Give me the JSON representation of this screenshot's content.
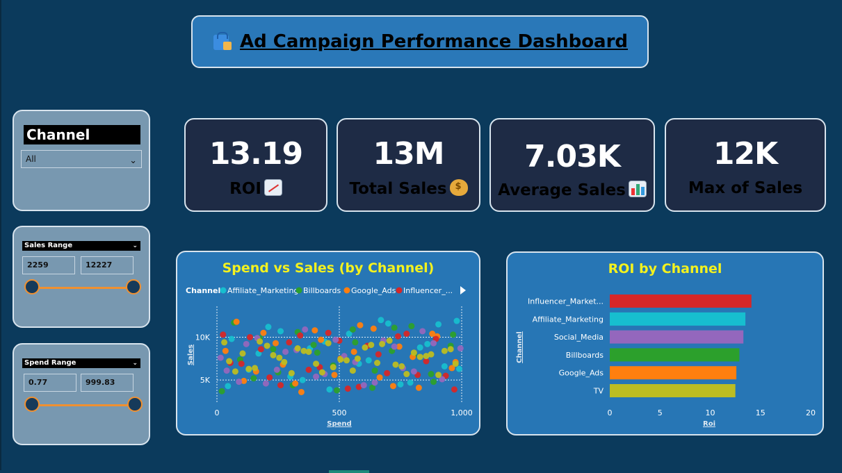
{
  "title": "Ad Campaign Performance Dashboard",
  "title_icon": "shopping-bags-icon",
  "filters": {
    "channel": {
      "label": "Channel",
      "value": "All"
    },
    "sales_range": {
      "label": "Sales Range",
      "min": "2259",
      "max": "12227"
    },
    "spend_range": {
      "label": "Spend Range",
      "min": "0.77",
      "max": "999.83"
    }
  },
  "kpis": [
    {
      "value": "13.19",
      "label": "ROI",
      "icon": "chart-increasing-icon"
    },
    {
      "value": "13M",
      "label": "Total Sales",
      "icon": "money-bag-icon"
    },
    {
      "value": "7.03K",
      "label": "Average Sales",
      "icon": "bar-chart-icon"
    },
    {
      "value": "12K",
      "label": "Max of Sales",
      "icon": ""
    }
  ],
  "colors": {
    "background": "#0b3a5c",
    "panel_blue": "#2776b5",
    "kpi_card": "#1e2b45",
    "chart_title": "#f4f21e",
    "slider": "#f09030",
    "Affiliate_Marketing": "#17becf",
    "Billboards": "#2ca02c",
    "Google_Ads": "#ff7f0e",
    "Influencer_Marketing": "#d62728",
    "Social_Media": "#9467bd",
    "TV": "#bcbd22"
  },
  "chart_data": [
    {
      "type": "scatter",
      "title": "Spend vs Sales (by Channel)",
      "xlabel": "Spend",
      "ylabel": "Sales",
      "legend_title": "Channel",
      "legend_entries": [
        "Affiliate_Marketing",
        "Billboards",
        "Google_Ads",
        "Influencer_..."
      ],
      "legend_position": "top",
      "xlim": [
        0,
        1000
      ],
      "ylim": [
        2259,
        12227
      ],
      "x_ticks": [
        "0",
        "500",
        "1,000"
      ],
      "y_ticks": [
        "5K",
        "10K"
      ],
      "series": [
        {
          "name": "Affiliate_Marketing",
          "x": [
            60,
            130,
            210,
            300,
            380,
            460,
            540,
            620,
            700,
            790,
            860,
            930,
            980,
            45,
            170,
            260,
            350,
            440,
            580,
            670,
            750,
            830,
            905,
            990
          ],
          "y": [
            9800,
            6200,
            11200,
            5400,
            8700,
            3900,
            10400,
            7300,
            11600,
            4700,
            9200,
            6600,
            11900,
            4300,
            8100,
            10700,
            5000,
            9500,
            6900,
            12000,
            4500,
            8800,
            11500,
            6300
          ]
        },
        {
          "name": "Billboards",
          "x": [
            20,
            95,
            175,
            250,
            330,
            410,
            490,
            565,
            645,
            725,
            805,
            885,
            965,
            70,
            150,
            230,
            310,
            395,
            475,
            555,
            635,
            715,
            795,
            875,
            955
          ],
          "y": [
            3700,
            7400,
            9900,
            5900,
            10600,
            8200,
            3800,
            9400,
            6100,
            11100,
            7900,
            4800,
            10300,
            11700,
            5200,
            8600,
            4400,
            9100,
            6700,
            10900,
            4100,
            8400,
            11300,
            5700,
            9000
          ]
        },
        {
          "name": "Google_Ads",
          "x": [
            35,
            110,
            190,
            270,
            345,
            425,
            505,
            585,
            665,
            745,
            825,
            900,
            975,
            80,
            160,
            240,
            320,
            400,
            480,
            560,
            640,
            720,
            800,
            880,
            960
          ],
          "y": [
            8400,
            4900,
            10500,
            6800,
            3600,
            9700,
            7500,
            11400,
            5300,
            8900,
            4100,
            10100,
            7100,
            11800,
            6000,
            9300,
            4600,
            10800,
            5600,
            8300,
            11000,
            4300,
            7700,
            10400,
            6400
          ]
        },
        {
          "name": "Influencer_Marketing",
          "x": [
            25,
            100,
            180,
            260,
            340,
            420,
            500,
            580,
            660,
            740,
            820,
            895,
            970,
            55,
            135,
            215,
            295,
            375,
            455,
            535,
            615,
            695,
            775,
            855,
            935
          ],
          "y": [
            10300,
            6900,
            8600,
            4400,
            10200,
            6500,
            9600,
            4200,
            8000,
            10100,
            5600,
            9800,
            3900,
            7000,
            10000,
            5300,
            9400,
            6200,
            10500,
            4000,
            9000,
            5800,
            10400,
            7200,
            5500
          ]
        },
        {
          "name": "Social_Media",
          "x": [
            40,
            120,
            200,
            280,
            360,
            440,
            520,
            600,
            680,
            760,
            840,
            920,
            995,
            15,
            90,
            165,
            245,
            325,
            405,
            485,
            565,
            645,
            725,
            805,
            885
          ],
          "y": [
            6100,
            9200,
            4600,
            8300,
            10900,
            5700,
            7800,
            4400,
            9600,
            6400,
            10700,
            5100,
            8700,
            7600,
            4800,
            9900,
            6200,
            8500,
            5400,
            9700,
            7100,
            4700,
            8900,
            6000,
            9300
          ]
        },
        {
          "name": "TV",
          "x": [
            50,
            105,
            155,
            205,
            255,
            305,
            355,
            405,
            455,
            505,
            555,
            605,
            655,
            705,
            755,
            805,
            855,
            905,
            955,
            30,
            130,
            230,
            330,
            430,
            530,
            630,
            730,
            830,
            930,
            75,
            175,
            275,
            375,
            475,
            575,
            675,
            775,
            875,
            975
          ],
          "y": [
            7200,
            8100,
            6400,
            9000,
            7600,
            5800,
            8400,
            6900,
            9300,
            7400,
            6100,
            8800,
            7000,
            9600,
            6600,
            8200,
            7800,
            5600,
            8600,
            9400,
            6300,
            7900,
            8700,
            5900,
            7300,
            9100,
            6800,
            7700,
            8400,
            6000,
            9500,
            7100,
            8300,
            6500,
            7500,
            9200,
            5700,
            8000,
            6900
          ]
        }
      ]
    },
    {
      "type": "bar",
      "orientation": "horizontal",
      "title": "ROI by Channel",
      "xlabel": "Roi",
      "ylabel": "Channel",
      "categories": [
        "Influencer_Market...",
        "Affiliate_Marketing",
        "Social_Media",
        "Billboards",
        "Google_Ads",
        "TV"
      ],
      "values": [
        14.1,
        13.5,
        13.3,
        12.9,
        12.6,
        12.5
      ],
      "xlim": [
        0,
        20
      ],
      "x_ticks": [
        "0",
        "5",
        "10",
        "15",
        "20"
      ]
    }
  ]
}
